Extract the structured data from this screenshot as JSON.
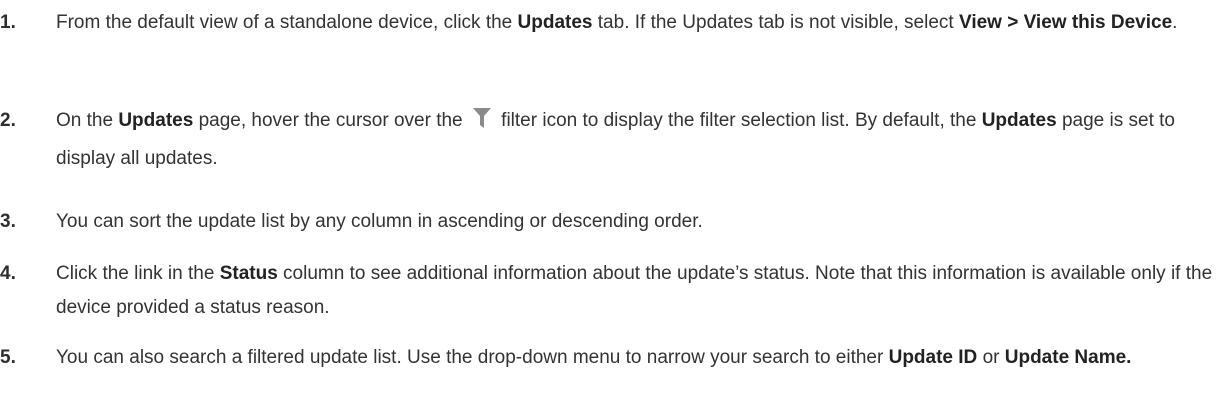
{
  "steps": [
    {
      "number": "1.",
      "parts": {
        "a": "From the default view of a standalone device, click the ",
        "b": "Updates",
        "c": " tab. If the Updates tab is not visible, select ",
        "d": "View > View this Device",
        "e": "."
      }
    },
    {
      "number": "2.",
      "parts": {
        "a": "On the ",
        "b": "Updates",
        "c": " page, hover the cursor over the ",
        "d": " filter icon to display the filter selection list. By default, the ",
        "e": "Updates",
        "f": " page is set to display all updates."
      },
      "icon": "filter-funnel-icon",
      "icon_color": "#8a8a8a"
    },
    {
      "number": "3.",
      "parts": {
        "a": "You can sort the update list by any column in ascending or descending order."
      }
    },
    {
      "number": "4.",
      "parts": {
        "a": "Click the link in the ",
        "b": "Status",
        "c": " column to see additional information about the update’s status. Note that this information is available only if the device provided a status reason."
      }
    },
    {
      "number": "5.",
      "parts": {
        "a": "You can also search a filtered update list. Use the drop-down menu to narrow your search to either ",
        "b": "Update ID",
        "c": " or ",
        "d": "Update Name."
      }
    }
  ]
}
